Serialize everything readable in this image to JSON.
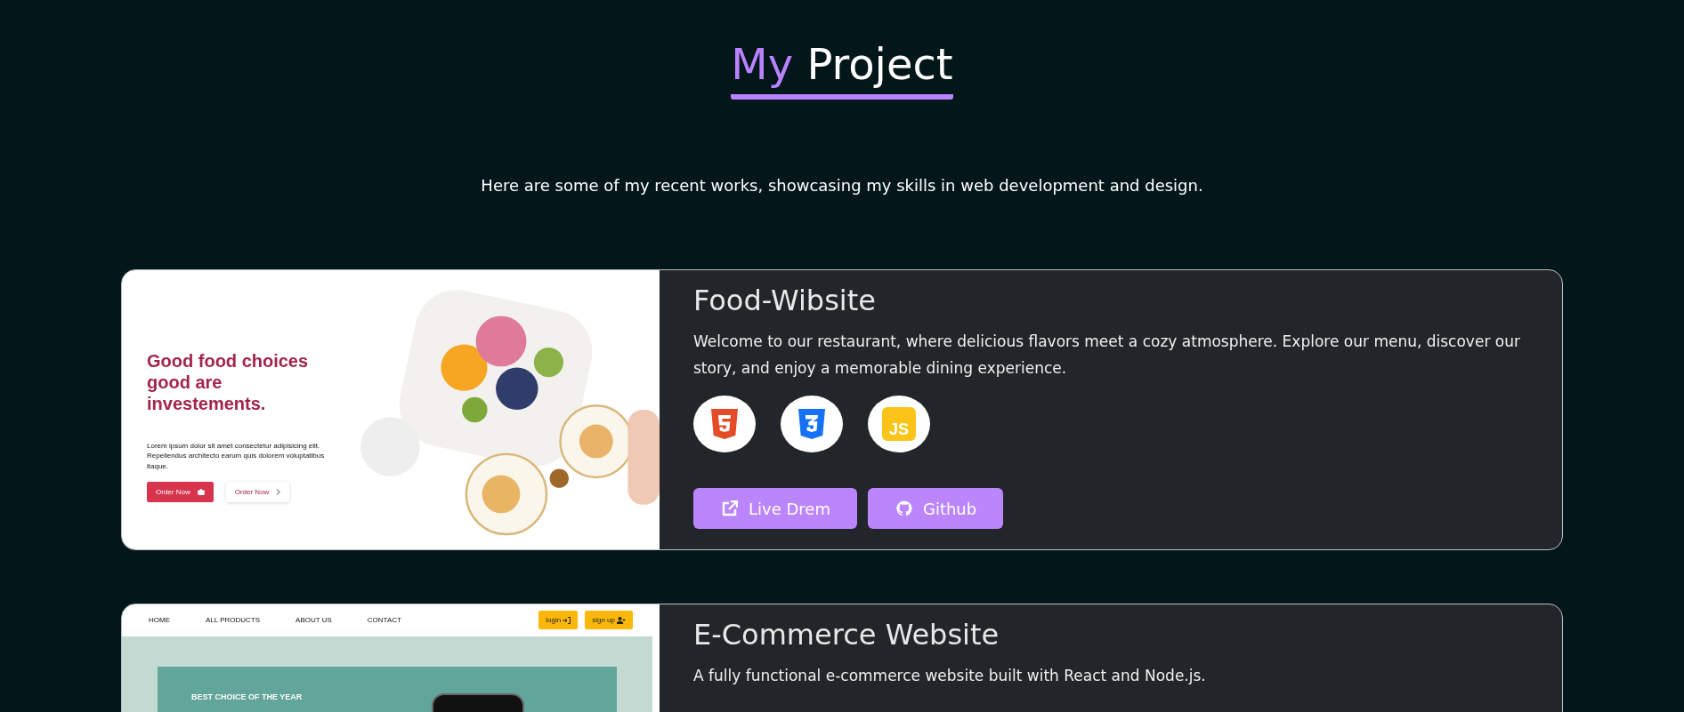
{
  "heading": {
    "highlight": "My",
    "rest": "Project"
  },
  "intro": "Here are some of my recent works, showcasing my skills in web development and design.",
  "projects": [
    {
      "title": "Food-Wibsite",
      "description": "Welcome to our restaurant, where delicious flavors meet a cozy atmosphere. Explore our menu, discover our story, and enjoy a memorable dining experience.",
      "preview": {
        "kind": "food",
        "headline": "Good food choices good are investements.",
        "text": "Lorem ipsum dolor sit amet consectetur adipisicing elit. Repellendus architecto earum quis dolorem voluptatibus itaque.",
        "buttons": [
          {
            "kind": "filled",
            "label": "Order Now"
          },
          {
            "kind": "outline",
            "label": "Order Now"
          }
        ]
      },
      "tech": [
        {
          "kind": "html"
        },
        {
          "kind": "css"
        },
        {
          "kind": "js",
          "label": "JS"
        }
      ],
      "links": [
        {
          "kind": "live",
          "label": "Live Drem"
        },
        {
          "kind": "github",
          "label": "Github"
        }
      ]
    },
    {
      "title": "E-Commerce Website",
      "description": "A fully functional e-commerce website built with React and Node.js.",
      "preview": {
        "kind": "shop",
        "nav": [
          "HOME",
          "ALL PRODUCTS",
          "ABOUT US",
          "CONTACT"
        ],
        "buttons": [
          {
            "kind": "login",
            "label": "login"
          },
          {
            "kind": "signup",
            "label": "sign up"
          }
        ],
        "tagline": "BEST CHOICE OF THE YEAR"
      }
    }
  ]
}
